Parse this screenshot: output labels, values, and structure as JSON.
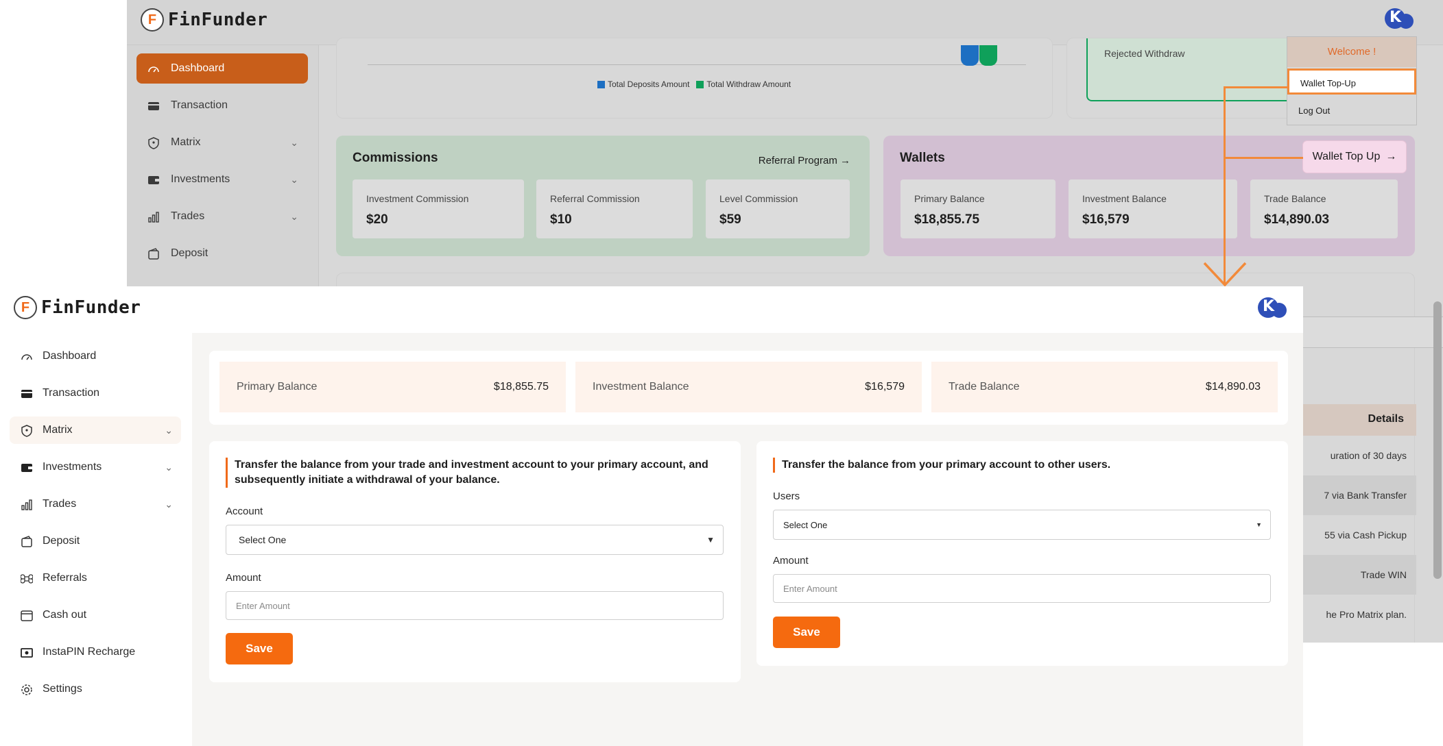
{
  "brand": {
    "name": "FinFunder",
    "logo_letter": "F"
  },
  "background": {
    "sidebar": [
      {
        "label": "Dashboard",
        "icon": "gauge-icon",
        "active": true
      },
      {
        "label": "Transaction",
        "icon": "card-icon"
      },
      {
        "label": "Matrix",
        "icon": "shield-icon",
        "chevron": true
      },
      {
        "label": "Investments",
        "icon": "wallet-icon",
        "chevron": true
      },
      {
        "label": "Trades",
        "icon": "bar-chart-icon",
        "chevron": true
      },
      {
        "label": "Deposit",
        "icon": "deposit-icon"
      }
    ],
    "chart_legend": {
      "deposits": "Total Deposits Amount",
      "withdraw": "Total Withdraw Amount"
    },
    "rejected_withdraw": "Rejected Withdraw",
    "commissions": {
      "title": "Commissions",
      "link": "Referral Program",
      "items": [
        {
          "label": "Investment Commission",
          "value": "$20"
        },
        {
          "label": "Referral Commission",
          "value": "$10"
        },
        {
          "label": "Level Commission",
          "value": "$59"
        }
      ]
    },
    "wallets": {
      "title": "Wallets",
      "topup_button": "Wallet Top Up",
      "items": [
        {
          "label": "Primary Balance",
          "value": "$18,855.75"
        },
        {
          "label": "Investment Balance",
          "value": "$16,579"
        },
        {
          "label": "Trade Balance",
          "value": "$14,890.03"
        }
      ]
    },
    "details_header": "Details",
    "details_rows": [
      "uration of 30 days",
      "7 via Bank Transfer",
      "55 via Cash Pickup",
      "Trade WIN",
      "he Pro Matrix plan."
    ],
    "dropdown": {
      "welcome": "Welcome !",
      "items": [
        "Wallet Top-Up",
        "Log Out"
      ]
    }
  },
  "sidebar": [
    {
      "label": "Dashboard",
      "icon": "gauge-icon"
    },
    {
      "label": "Transaction",
      "icon": "card-icon"
    },
    {
      "label": "Matrix",
      "icon": "shield-icon",
      "chevron": true,
      "active": true
    },
    {
      "label": "Investments",
      "icon": "wallet-icon",
      "chevron": true
    },
    {
      "label": "Trades",
      "icon": "bar-chart-icon",
      "chevron": true
    },
    {
      "label": "Deposit",
      "icon": "deposit-icon"
    },
    {
      "label": "Referrals",
      "icon": "command-icon"
    },
    {
      "label": "Cash out",
      "icon": "cashout-icon"
    },
    {
      "label": "InstaPIN Recharge",
      "icon": "pin-card-icon"
    },
    {
      "label": "Settings",
      "icon": "gear-icon"
    }
  ],
  "balances": [
    {
      "label": "Primary Balance",
      "value": "$18,855.75"
    },
    {
      "label": "Investment Balance",
      "value": "$16,579"
    },
    {
      "label": "Trade Balance",
      "value": "$14,890.03"
    }
  ],
  "form_left": {
    "title": "Transfer the balance from your trade and investment account to your primary account, and subsequently initiate a withdrawal of your balance.",
    "account_label": "Account",
    "account_value": "Select One",
    "amount_label": "Amount",
    "amount_placeholder": "Enter Amount",
    "save": "Save"
  },
  "form_right": {
    "title": "Transfer the balance from your primary account to other users.",
    "users_label": "Users",
    "users_value": "Select One",
    "amount_label": "Amount",
    "amount_placeholder": "Enter Amount",
    "save": "Save"
  },
  "colors": {
    "accent": "#f56a0f",
    "highlight": "#f28a3a",
    "deposits": "#1d6fc2",
    "withdraw": "#0fa05a"
  }
}
